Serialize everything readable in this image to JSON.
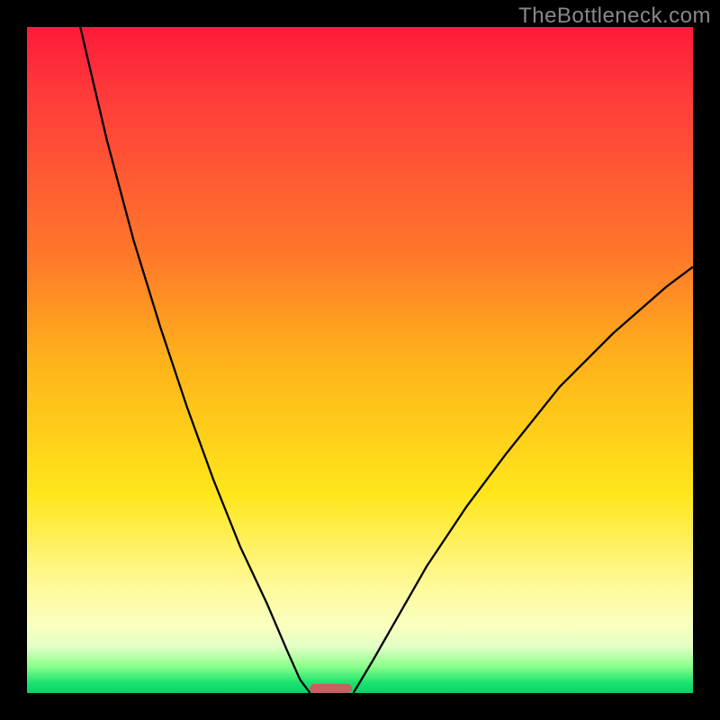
{
  "watermark": "TheBottleneck.com",
  "chart_data": {
    "type": "line",
    "title": "",
    "xlabel": "",
    "ylabel": "",
    "xlim": [
      0,
      100
    ],
    "ylim": [
      0,
      100
    ],
    "background_gradient_stops": [
      {
        "pos": 0,
        "color": "#ff1a3a"
      },
      {
        "pos": 35,
        "color": "#ff7a2a"
      },
      {
        "pos": 70,
        "color": "#ffe61a"
      },
      {
        "pos": 90,
        "color": "#f8ffbf"
      },
      {
        "pos": 98,
        "color": "#18e36e"
      },
      {
        "pos": 100,
        "color": "#10d068"
      }
    ],
    "series": [
      {
        "name": "left-curve",
        "x": [
          8,
          12,
          16,
          20,
          24,
          28,
          32,
          36,
          39,
          41,
          42.5
        ],
        "y": [
          100,
          83,
          68,
          55,
          43,
          32,
          22,
          13.5,
          6.5,
          2,
          0
        ]
      },
      {
        "name": "right-curve",
        "x": [
          49,
          52,
          56,
          60,
          66,
          72,
          80,
          88,
          96,
          100
        ],
        "y": [
          0,
          5,
          12,
          19,
          28,
          36,
          46,
          54,
          61,
          64
        ]
      }
    ],
    "marker": {
      "name": "bottleneck-marker",
      "x_center": 45.6,
      "y_bottom": 0,
      "width_pct": 6.3,
      "height_pct": 1.4,
      "color": "#c46060"
    }
  }
}
